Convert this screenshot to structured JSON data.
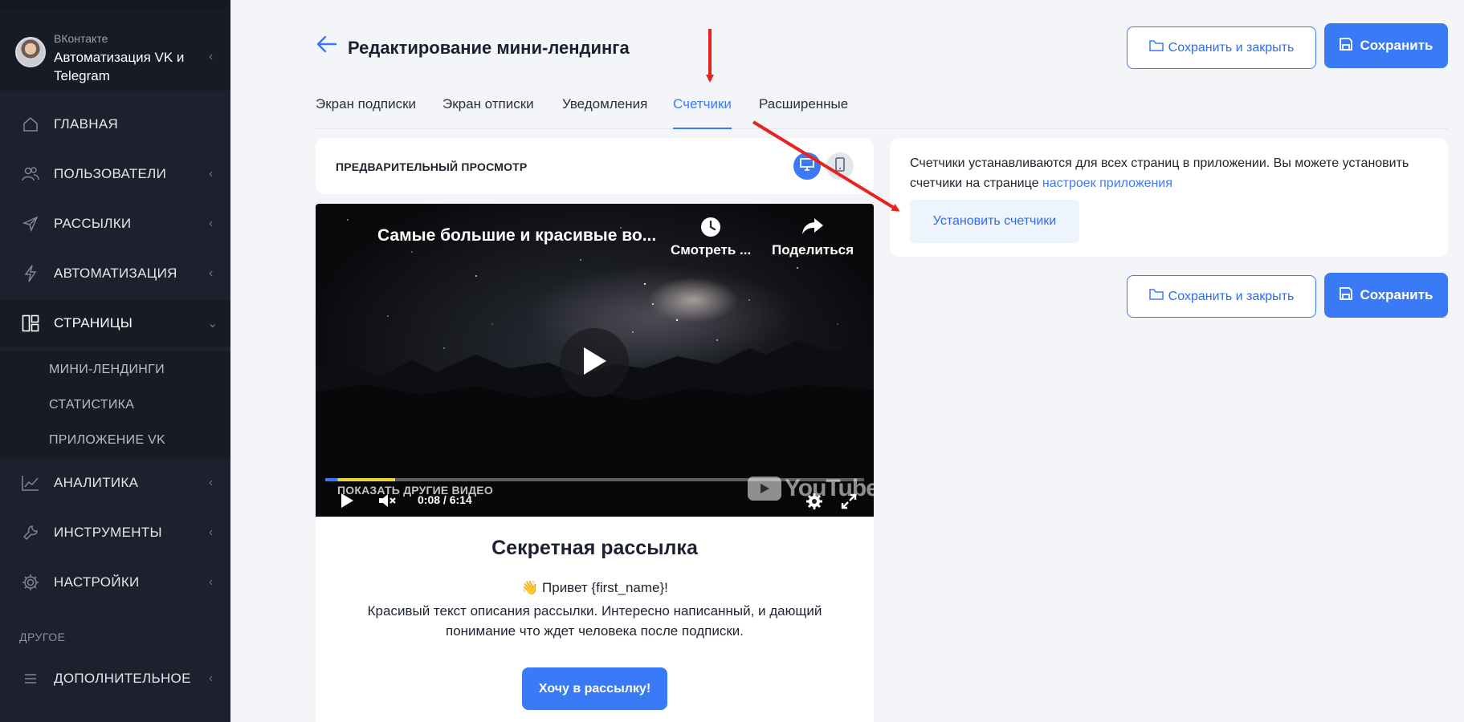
{
  "account": {
    "platform": "ВКонтакте",
    "name": "Автоматизация VK и Telegram"
  },
  "nav": {
    "home": "ГЛАВНАЯ",
    "users": "ПОЛЬЗОВАТЕЛИ",
    "mailings": "РАССЫЛКИ",
    "automation": "АВТОМАТИЗАЦИЯ",
    "pages": "СТРАНИЦЫ",
    "pages_sub": [
      "МИНИ-ЛЕНДИНГИ",
      "СТАТИСТИКА",
      "ПРИЛОЖЕНИЕ VK"
    ],
    "analytics": "АНАЛИТИКА",
    "tools": "ИНСТРУМЕНТЫ",
    "settings": "НАСТРОЙКИ",
    "other_section": "ДРУГОЕ",
    "additional": "ДОПОЛНИТЕЛЬНОЕ"
  },
  "header": {
    "title": "Редактирование мини-лендинга",
    "save_close": "Сохранить и закрыть",
    "save": "Сохранить"
  },
  "tabs": [
    "Экран подписки",
    "Экран отписки",
    "Уведомления",
    "Счетчики",
    "Расширенные"
  ],
  "active_tab": "Счетчики",
  "preview": {
    "label": "ПРЕДВАРИТЕЛЬНЫЙ ПРОСМОТР",
    "video": {
      "title": "Самые большие и красивые во...",
      "watch_later": "Смотреть ...",
      "share": "Поделиться",
      "more_videos": "ПОКАЗАТЬ ДРУГИЕ ВИДЕО",
      "time": "0:08 / 6:14",
      "brand": "YouTube",
      "progress": 0.13
    },
    "landing": {
      "title": "Секретная рассылка",
      "greeting": "👋 Привет {first_name}!",
      "text": "Красивый текст описания рассылки. Интересно написанный, и дающий понимание что ждет человека после подписки.",
      "button": "Хочу в рассылку!"
    }
  },
  "counters": {
    "text": "Счетчики устанавливаются для всех страниц в приложении. Вы можете установить счетчики на странице",
    "link": "настроек приложения",
    "button": "Установить счетчики"
  },
  "footer_actions": {
    "save_close": "Сохранить и закрыть",
    "save": "Сохранить"
  },
  "colors": {
    "accent": "#3b7af6",
    "sidebar_bg": "#1c212d",
    "annotation_arrow": "#e8231f"
  }
}
